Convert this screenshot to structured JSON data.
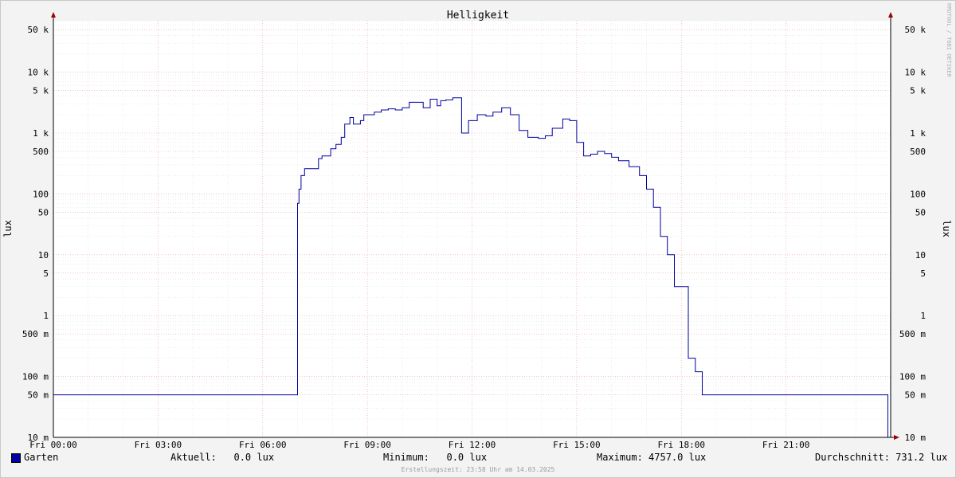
{
  "chart_data": {
    "type": "line",
    "title": "Helligkeit",
    "ylabel": "lux",
    "y_scale": "log",
    "ylim": [
      10,
      100000
    ],
    "x_ticks": [
      "Fri 00:00",
      "Fri 03:00",
      "Fri 06:00",
      "Fri 09:00",
      "Fri 12:00",
      "Fri 15:00",
      "Fri 18:00",
      "Fri 21:00"
    ],
    "y_ticks": [
      {
        "value": 10,
        "label": "10 m"
      },
      {
        "value": 50,
        "label": "50 m"
      },
      {
        "value": 100,
        "label": "100 m"
      },
      {
        "value": 500,
        "label": "500 m"
      },
      {
        "value": 1000,
        "label": "1"
      },
      {
        "value": 5000,
        "label": "5"
      },
      {
        "value": 10000,
        "label": "10"
      },
      {
        "value": 50000,
        "label": "50"
      },
      {
        "value": 100000,
        "label": "100"
      },
      {
        "value": 500000,
        "label": "500"
      },
      {
        "value": 1000000,
        "label": "1 k"
      },
      {
        "value": 5000000,
        "label": "5 k"
      },
      {
        "value": 10000000,
        "label": "10 k"
      },
      {
        "value": 50000000,
        "label": "50 k"
      }
    ],
    "grid": true,
    "legend_position": "bottom-left",
    "series": [
      {
        "name": "Garten",
        "color": "#0000a0",
        "x_hours": [
          0,
          6.95,
          7.0,
          7.04,
          7.1,
          7.2,
          7.3,
          7.6,
          7.7,
          7.95,
          8.1,
          8.25,
          8.35,
          8.5,
          8.6,
          8.8,
          8.9,
          9.2,
          9.4,
          9.6,
          9.8,
          10.0,
          10.2,
          10.6,
          10.8,
          11.0,
          11.1,
          11.25,
          11.45,
          11.7,
          11.9,
          12.15,
          12.4,
          12.6,
          12.85,
          13.1,
          13.35,
          13.6,
          13.9,
          14.1,
          14.3,
          14.6,
          14.8,
          15.0,
          15.2,
          15.4,
          15.6,
          15.8,
          16.0,
          16.2,
          16.5,
          16.8,
          17.0,
          17.2,
          17.4,
          17.6,
          17.8,
          18.0,
          18.2,
          18.4,
          18.6,
          18.7,
          18.8,
          18.95,
          19.1,
          19.2,
          19.25,
          19.4,
          19.45,
          19.5,
          23.9,
          23.92,
          24.0
        ],
        "y_mlux": [
          50,
          50,
          70000,
          120000,
          200000,
          260000,
          260000,
          380000,
          420000,
          550000,
          650000,
          850000,
          1400000,
          1800000,
          1400000,
          1600000,
          2000000,
          2200000,
          2400000,
          2500000,
          2400000,
          2600000,
          3200000,
          2600000,
          3600000,
          2800000,
          3400000,
          3500000,
          3800000,
          1000000,
          1600000,
          2000000,
          1900000,
          2200000,
          2600000,
          2000000,
          1100000,
          850000,
          820000,
          900000,
          1200000,
          1700000,
          1600000,
          700000,
          420000,
          450000,
          500000,
          460000,
          400000,
          350000,
          280000,
          200000,
          120000,
          60000,
          20000,
          10000,
          3000,
          3000,
          200,
          120,
          50,
          50,
          50,
          50,
          50,
          50,
          50,
          50,
          50,
          50,
          50,
          10,
          10
        ],
        "y_points_shown": true
      }
    ]
  },
  "legend": {
    "series_label": "Garten",
    "aktuell": "Aktuell:   0.0 lux",
    "minimum": "Minimum:   0.0 lux",
    "maximum": "Maximum: 4757.0 lux",
    "durchschnitt": "Durchschnitt: 731.2 lux"
  },
  "watermark": "RRDTOOL / TOBI OETIKER",
  "footer": "Erstellungszeit: 23:58 Uhr am 14.03.2025"
}
